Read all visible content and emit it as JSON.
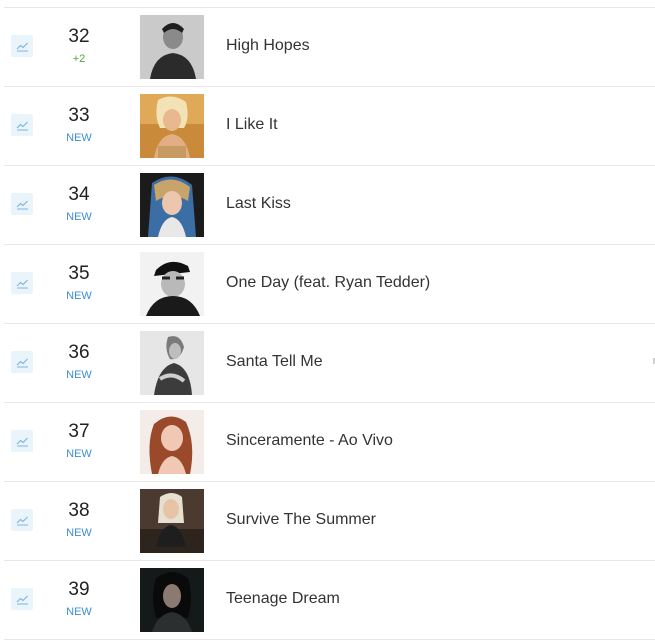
{
  "colors": {
    "new_badge": "#3a8fd6",
    "up_badge": "#52a53c",
    "trend_button_bg": "#e9f4fb",
    "divider": "#e8e8e8"
  },
  "chart": {
    "rows": [
      {
        "rank": "32",
        "change": "+2",
        "change_type": "up",
        "title": "High Hopes",
        "icon": "trend-chart-icon"
      },
      {
        "rank": "33",
        "change": "NEW",
        "change_type": "new",
        "title": "I Like It",
        "icon": "trend-chart-icon"
      },
      {
        "rank": "34",
        "change": "NEW",
        "change_type": "new",
        "title": "Last Kiss",
        "icon": "trend-chart-icon"
      },
      {
        "rank": "35",
        "change": "NEW",
        "change_type": "new",
        "title": "One Day (feat. Ryan Tedder)",
        "icon": "trend-chart-icon"
      },
      {
        "rank": "36",
        "change": "NEW",
        "change_type": "new",
        "title": "Santa Tell Me",
        "icon": "trend-chart-icon"
      },
      {
        "rank": "37",
        "change": "NEW",
        "change_type": "new",
        "title": "Sinceramente - Ao Vivo",
        "icon": "trend-chart-icon"
      },
      {
        "rank": "38",
        "change": "NEW",
        "change_type": "new",
        "title": "Survive The Summer",
        "icon": "trend-chart-icon"
      },
      {
        "rank": "39",
        "change": "NEW",
        "change_type": "new",
        "title": "Teenage Dream",
        "icon": "trend-chart-icon"
      }
    ]
  }
}
